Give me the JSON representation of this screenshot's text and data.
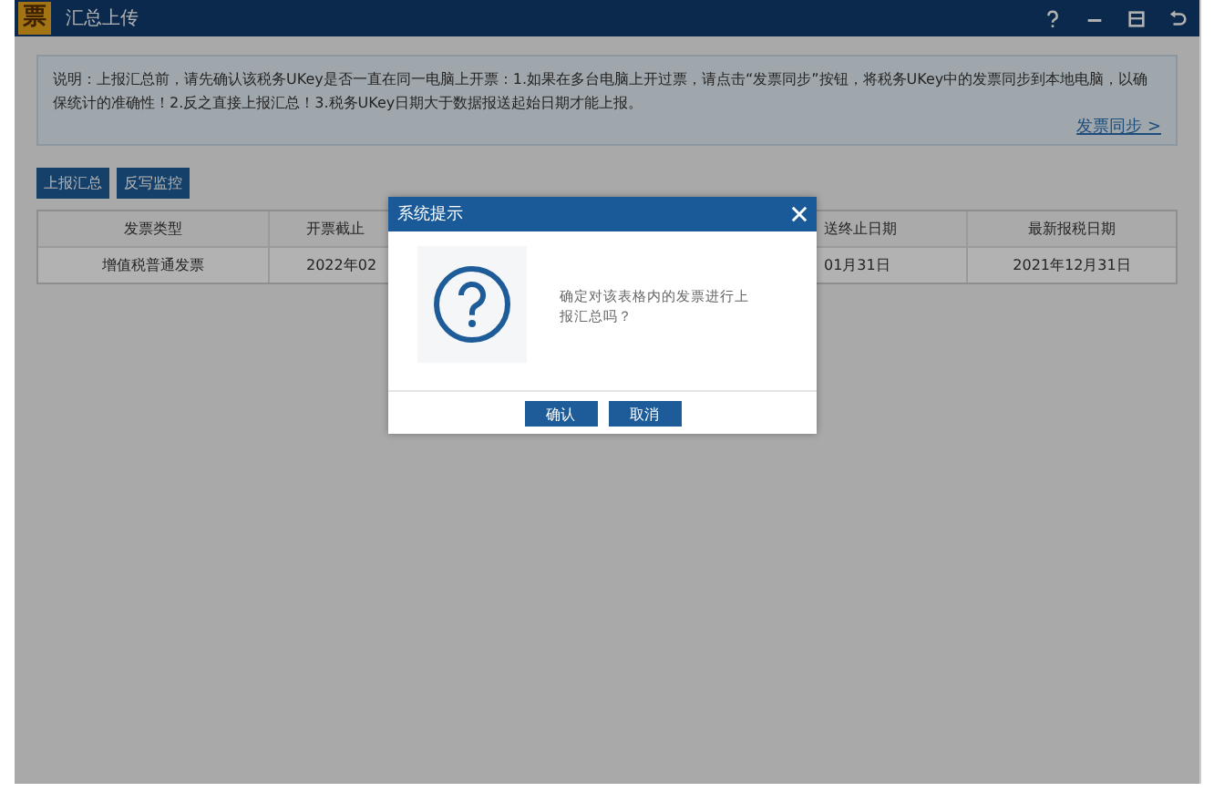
{
  "window": {
    "title": "汇总上传",
    "logo": "票"
  },
  "notice": {
    "text": "说明：上报汇总前，请先确认该税务UKey是否一直在同一电脑上开票：1.如果在多台电脑上开过票，请点击“发票同步”按钮，将税务UKey中的发票同步到本地电脑，以确保统计的准确性！2.反之直接上报汇总！3.税务UKey日期大于数据报送起始日期才能上报。",
    "link": "发票同步 >"
  },
  "toolbar": [
    "上报汇总",
    "反写监控"
  ],
  "table": {
    "columns": [
      "发票类型",
      "开票截止",
      "送终止日期",
      "最新报税日期"
    ],
    "rows": [
      [
        "增值税普通发票",
        "2022年02",
        "01月31日",
        "2021年12月31日"
      ]
    ]
  },
  "dialog": {
    "title": "系统提示",
    "message": "确定对该表格内的发票进行上报汇总吗？",
    "buttons": [
      "确认",
      "取消"
    ]
  }
}
